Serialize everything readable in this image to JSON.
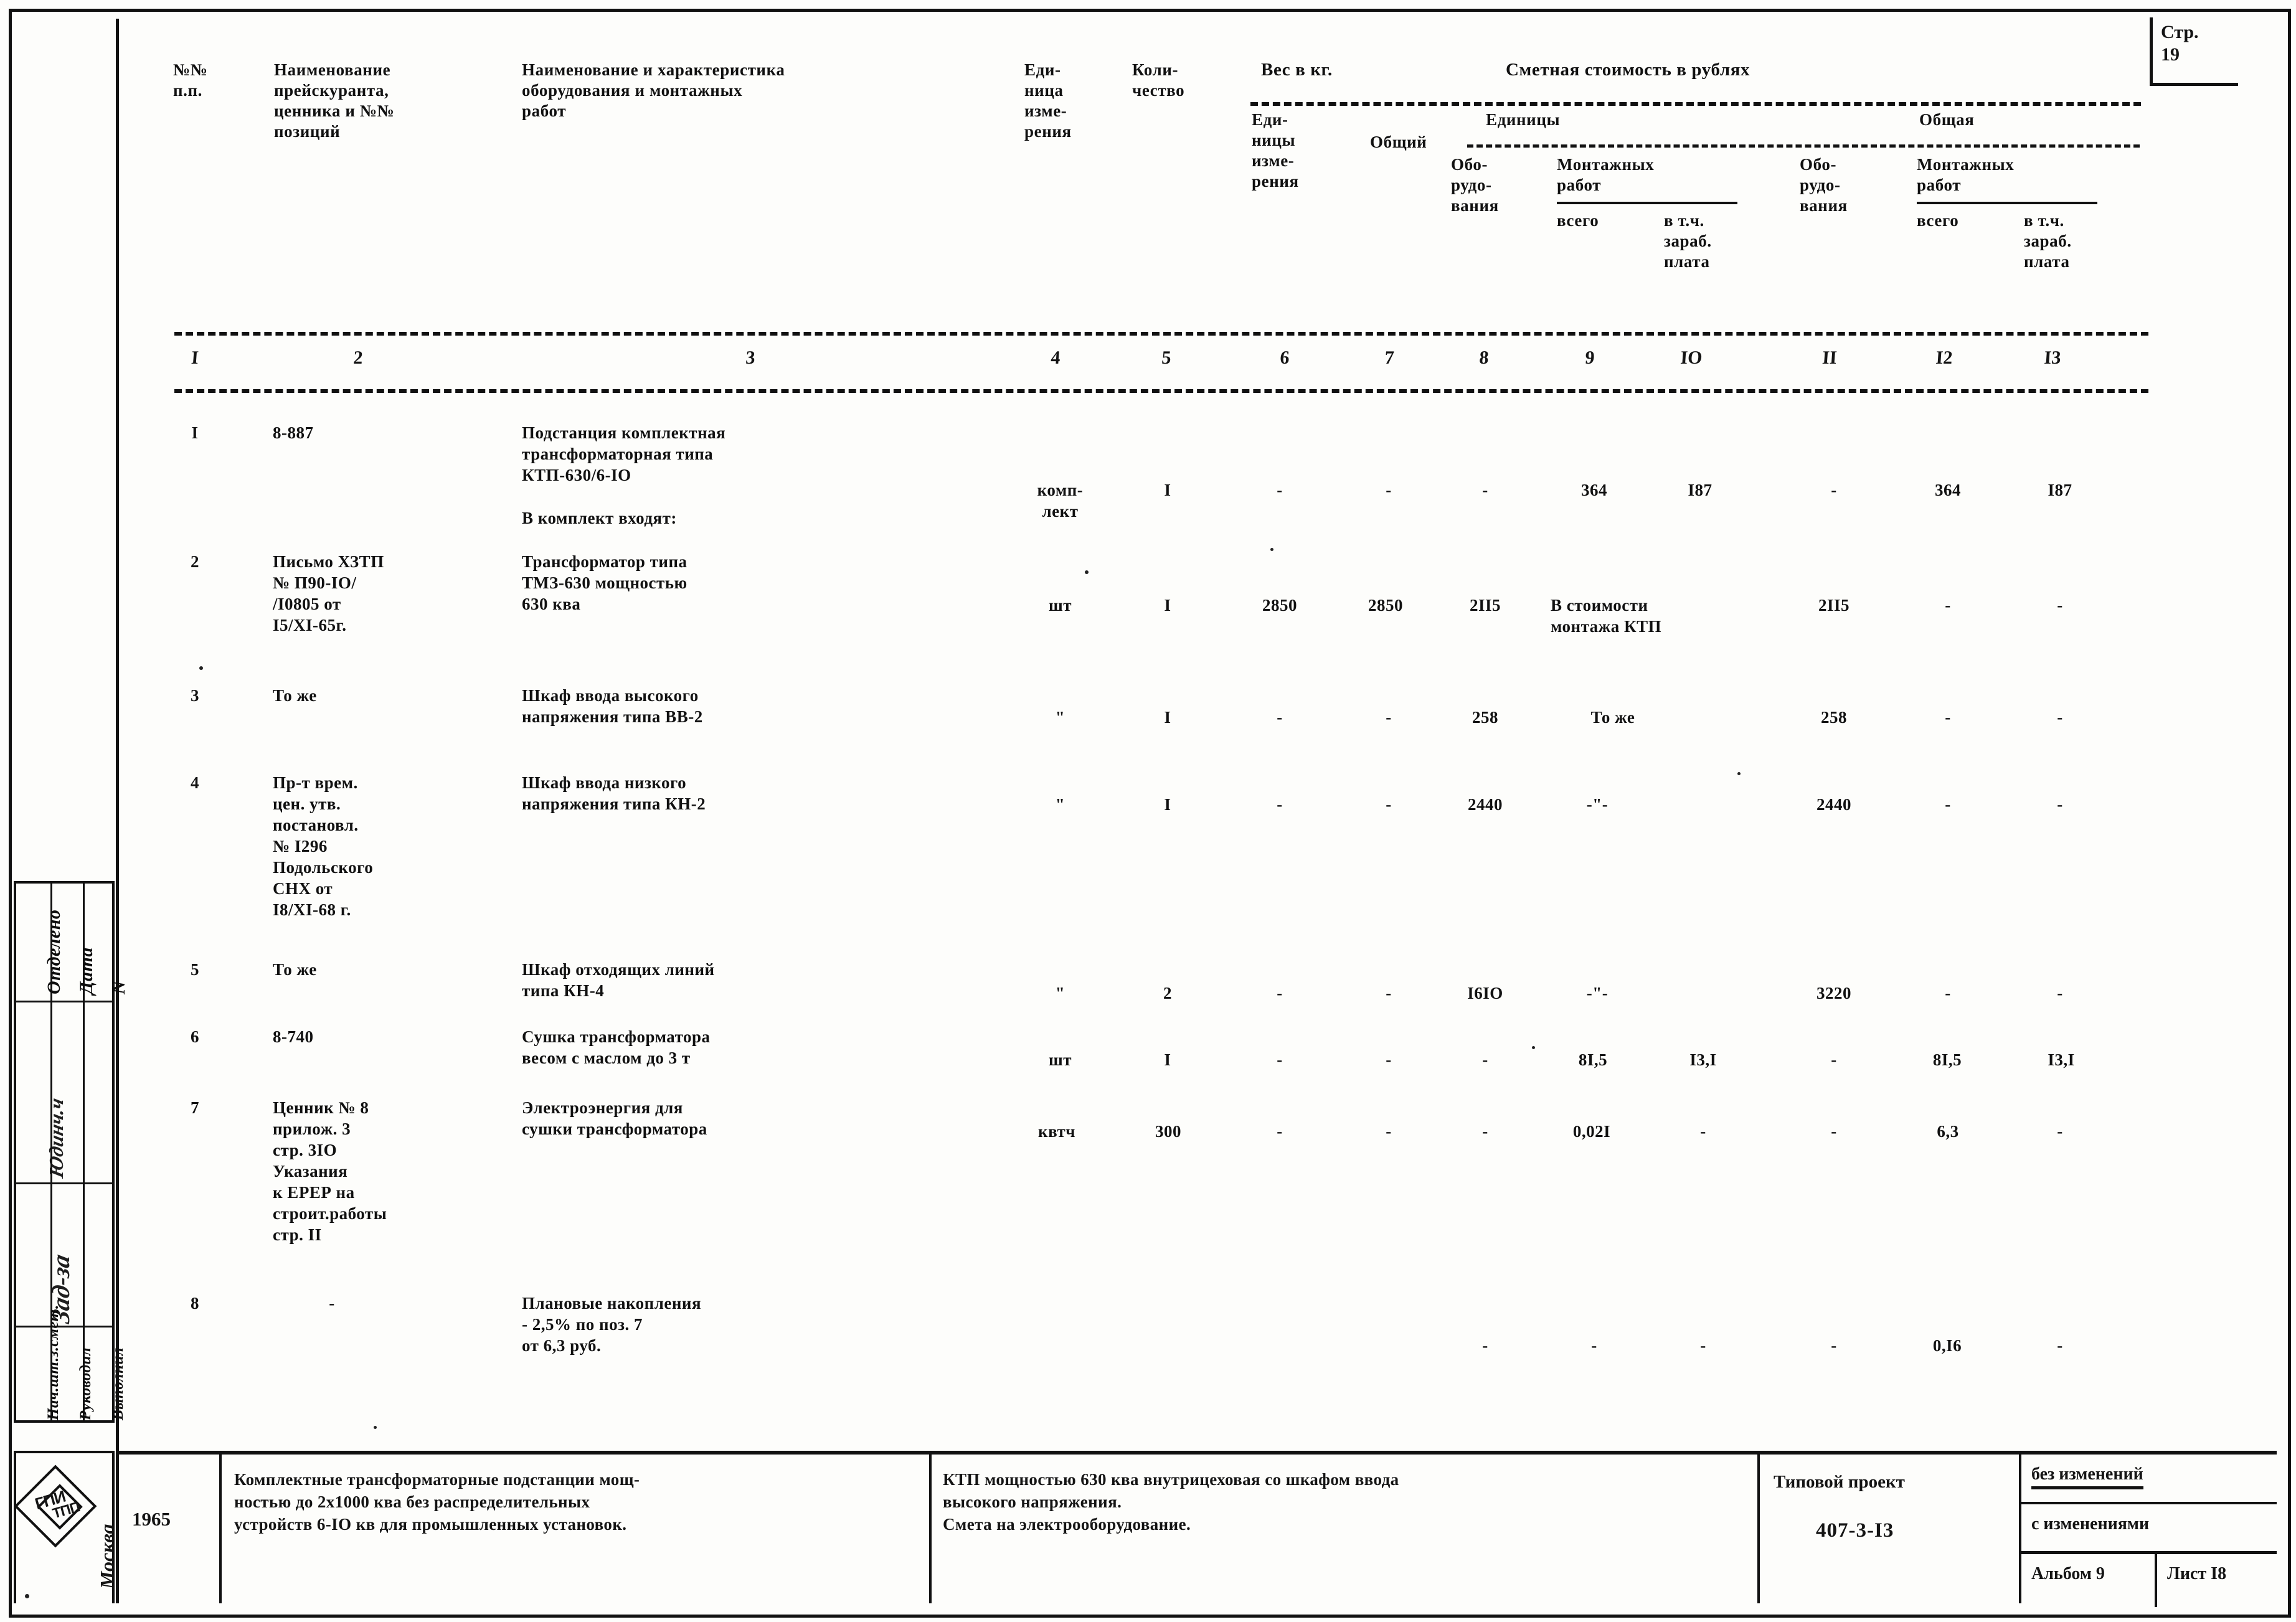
{
  "page": {
    "page_label": "Стр.\n19",
    "sheet_year": "1965",
    "logo_line1": "ГПИ",
    "logo_line2": "ТПП",
    "logo_city": "Москва"
  },
  "sidebar": {
    "row_labels_top": [
      "Отделено",
      "Дата",
      "N"
    ],
    "signatures": [
      "Юдинч.ч",
      "Зад-за"
    ],
    "role_labels": [
      "Нач.шт.з.смет.",
      "Руководил",
      "Выполнил"
    ]
  },
  "table_header": {
    "col1": "№№\nп.п.",
    "col2": "Наименование\nпрейскуранта,\nценника и №№\nпозиций",
    "col3": "Наименование и характеристика\nоборудования и монтажных\nработ",
    "col4": "Еди-\nница\nизме-\nрения",
    "col5": "Коли-\nчество",
    "weight_group": "Вес в кг.",
    "col6": "Еди-\nницы\nизме-\nрения",
    "col7": "Общий",
    "cost_group": "Сметная стоимость в рублях",
    "unit_group": "Единицы",
    "total_group": "Общая",
    "col8": "Обо-\nрудо-\nвания",
    "col9_10_group": "Монтажных\nработ",
    "col9": "всего",
    "col10": "в т.ч.\nзараб.\nплата",
    "col11": "Обо-\nрудо-\nвания",
    "col12_13_group": "Монтажных\nработ",
    "col12": "всего",
    "col13": "в т.ч.\nзараб.\nплата",
    "numbering": [
      "I",
      "2",
      "3",
      "4",
      "5",
      "6",
      "7",
      "8",
      "9",
      "IO",
      "II",
      "I2",
      "I3"
    ]
  },
  "rows": [
    {
      "no": "I",
      "source": "8-887",
      "description": "Подстанция комплектная\nтрансформаторная типа\nКТП-630/6-IO",
      "description2": "В комплект входят:",
      "unit": "комп-\nлект",
      "qty": "I",
      "w_unit": "-",
      "w_total": "-",
      "c_equip_unit": "-",
      "c_mount_all_unit": "364",
      "c_mount_wage_unit": "I87",
      "c_equip_total": "-",
      "c_mount_all_total": "364",
      "c_mount_wage_total": "I87"
    },
    {
      "no": "2",
      "source": "Письмо ХЗТП\n№ П90-IO/\n/I0805 от\nI5/XI-65г.",
      "description": "Трансформатор типа\nТМЗ-630 мощностью\n630 ква",
      "unit": "шт",
      "qty": "I",
      "w_unit": "2850",
      "w_total": "2850",
      "c_equip_unit": "2II5",
      "c_mount_all_unit": "В стоимости\nмонтажа КТП",
      "c_mount_wage_unit": "",
      "c_equip_total": "2II5",
      "c_mount_all_total": "-",
      "c_mount_wage_total": "-"
    },
    {
      "no": "3",
      "source": "То же",
      "description": "Шкаф ввода высокого\nнапряжения типа ВВ-2",
      "unit": "\"",
      "qty": "I",
      "w_unit": "-",
      "w_total": "-",
      "c_equip_unit": "258",
      "c_mount_all_unit": "То же",
      "c_mount_wage_unit": "",
      "c_equip_total": "258",
      "c_mount_all_total": "-",
      "c_mount_wage_total": "-"
    },
    {
      "no": "4",
      "source": "Пр-т врем.\nцен. утв.\nпостановл.\n№ I296\nПодольского\nСНХ от\nI8/XI-68 г.",
      "description": "Шкаф ввода низкого\nнапряжения типа КН-2",
      "unit": "\"",
      "qty": "I",
      "w_unit": "-",
      "w_total": "-",
      "c_equip_unit": "2440",
      "c_mount_all_unit": "-\"-",
      "c_mount_wage_unit": "",
      "c_equip_total": "2440",
      "c_mount_all_total": "-",
      "c_mount_wage_total": "-"
    },
    {
      "no": "5",
      "source": "То же",
      "description": "Шкаф отходящих линий\nтипа КН-4",
      "unit": "\"",
      "qty": "2",
      "w_unit": "-",
      "w_total": "-",
      "c_equip_unit": "I6IO",
      "c_mount_all_unit": "-\"-",
      "c_mount_wage_unit": "",
      "c_equip_total": "3220",
      "c_mount_all_total": "-",
      "c_mount_wage_total": "-"
    },
    {
      "no": "6",
      "source": "8-740",
      "description": "Сушка трансформатора\nвесом с маслом до 3 т",
      "unit": "шт",
      "qty": "I",
      "w_unit": "-",
      "w_total": "-",
      "c_equip_unit": "-",
      "c_mount_all_unit": "8I,5",
      "c_mount_wage_unit": "I3,I",
      "c_equip_total": "-",
      "c_mount_all_total": "8I,5",
      "c_mount_wage_total": "I3,I"
    },
    {
      "no": "7",
      "source": "Ценник № 8\nприлож. 3\nстр. 3IO\nУказания\nк ЕРЕР на\nстроит.работы\nстр. II",
      "description": "Электроэнергия для\nсушки трансформатора",
      "unit": "квтч",
      "qty": "300",
      "w_unit": "-",
      "w_total": "-",
      "c_equip_unit": "-",
      "c_mount_all_unit": "0,02I",
      "c_mount_wage_unit": "-",
      "c_equip_total": "-",
      "c_mount_all_total": "6,3",
      "c_mount_wage_total": "-"
    },
    {
      "no": "8",
      "source": "-",
      "description": "Плановые накопления\n- 2,5% по поз. 7\nот 6,3 руб.",
      "unit": "",
      "qty": "",
      "w_unit": "",
      "w_total": "",
      "c_equip_unit": "-",
      "c_mount_all_unit": "-",
      "c_mount_wage_unit": "-",
      "c_equip_total": "-",
      "c_mount_all_total": "0,I6",
      "c_mount_wage_total": "-"
    }
  ],
  "title_block": {
    "year": "1965",
    "series_description": "Комплектные трансформаторные подстанции мощ-\nностью до 2х1000 ква без распределительных\nустройств 6-IO кв для промышленных установок.",
    "object_description": "КТП мощностью 630 ква внутрицеховая со шкафом ввода\nвысокого напряжения.\nСмета на электрооборудование.",
    "project_label": "Типовой проект",
    "project_code": "407-3-I3",
    "change_no": "без изменений",
    "change_with": "с изменениями",
    "album": "Альбом 9",
    "sheet": "Лист I8"
  }
}
